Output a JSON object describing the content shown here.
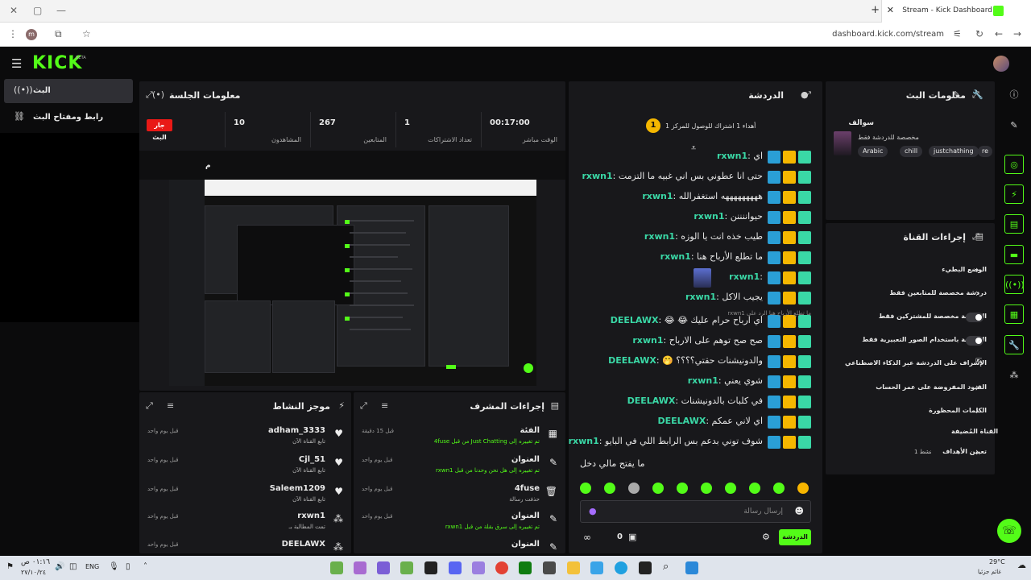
{
  "browser": {
    "tab_title": "Stream - Kick Dashboard",
    "tab_close": "✕",
    "new_tab": "+",
    "url": "dashboard.kick.com/stream",
    "profile_initial": "m"
  },
  "app": {
    "logo": "KICK",
    "beta": "BETA"
  },
  "nav": {
    "items": [
      {
        "label": "البث",
        "icon": "stream-icon"
      },
      {
        "label": "رابط ومفتاح البث",
        "icon": "link-icon"
      }
    ]
  },
  "session": {
    "title": "معلومات الجلسة",
    "live_badge": "جار البث",
    "stats": [
      {
        "value": "00:17:00",
        "label": "الوقت مباشر"
      },
      {
        "value": "1",
        "label": "تعداد الاشتراكات"
      },
      {
        "value": "267",
        "label": "المتابعين"
      },
      {
        "value": "10",
        "label": "المشاهدون"
      }
    ],
    "m_label": "م"
  },
  "chat": {
    "title": "الدردشة",
    "pinned": "أهداء 1 اشتراك للوصول للمركز 1",
    "pinned_rank": "1",
    "reply_hint": "ما تطلع الأرباح هنا",
    "reply_user": "الرد على rxwn1",
    "messages": [
      {
        "user": "rxwn1",
        "color": "#3ad8a6",
        "text": "اي"
      },
      {
        "user": "rxwn1",
        "color": "#3ad8a6",
        "text": "حتى انا عطوني بس اني غبيه ما التزمت"
      },
      {
        "user": "rxwn1",
        "color": "#3ad8a6",
        "text": "هههههههههه استغفرالله"
      },
      {
        "user": "rxwn1",
        "color": "#3ad8a6",
        "text": "حيواننننن"
      },
      {
        "user": "rxwn1",
        "color": "#3ad8a6",
        "text": "طيب خذه انت يا الوزه"
      },
      {
        "user": "rxwn1",
        "color": "#3ad8a6",
        "text": "ما تطلع الأرباح هنا"
      },
      {
        "user": "rxwn1",
        "color": "#3ad8a6",
        "text": ""
      },
      {
        "user": "rxwn1",
        "color": "#3ad8a6",
        "text": "يجيب الاكل"
      },
      {
        "user": "DEELAWX",
        "color": "#3ad8a6",
        "text": "اي ارباح حرام عليك 😂 😂"
      },
      {
        "user": "rxwn1",
        "color": "#3ad8a6",
        "text": "صح صح توهم على الارباح"
      },
      {
        "user": "DEELAWX",
        "color": "#3ad8a6",
        "text": "والدونيشنات حقتي؟؟؟؟ 🤭"
      },
      {
        "user": "rxwn1",
        "color": "#3ad8a6",
        "text": "شوي يعني"
      },
      {
        "user": "DEELAWX",
        "color": "#3ad8a6",
        "text": "في كلبات بالدونيشنات"
      },
      {
        "user": "DEELAWX",
        "color": "#3ad8a6",
        "text": "اي لاني عمكم"
      },
      {
        "user": "rxwn1",
        "color": "#3ad8a6",
        "text": "شوف توني بدعم بس الرابط اللي في البايو"
      }
    ],
    "last_line": "ما يفتح مالي دخل",
    "input_placeholder": "إرسال رسالة",
    "send_label": "الدردشة",
    "count": "0"
  },
  "stream_info": {
    "title": "معلومات البث",
    "stream_title": "سوالف",
    "subtitle": "مخصصة للدردشة فقط",
    "tags": [
      "Arabic",
      "chill",
      "justchathing",
      "re"
    ]
  },
  "channel_actions": {
    "title": "إجراءات القناة",
    "rows": [
      {
        "label": "الوضع البطيء",
        "ctl": "chevron"
      },
      {
        "label": "دردشة مخصصة للمتابعين فقط",
        "ctl": "chevron"
      },
      {
        "label": "الدردشة مخصصة للمشتركين فقط",
        "ctl": "toggle"
      },
      {
        "label": "الدردشة باستخدام الصور التعبيرية فقط",
        "ctl": "toggle"
      },
      {
        "label": "الإشراف على الدردشة عبر الذكاء الاصطناعي",
        "ctl": "ext"
      },
      {
        "label": "القيود المفروضة على عمر الحساب",
        "ctl": "chevron"
      },
      {
        "label": "الكلمات المحظورة",
        "ctl": "chevron"
      }
    ],
    "featured_label": "القناة المُضيفة",
    "goals_label": "تعيين الأهداف",
    "goals_value": "1 نشط"
  },
  "activity": {
    "title": "موجز النشاط",
    "items": [
      {
        "user": "adham_3333",
        "sub": "تابع القناة الآن",
        "time": "قبل يوم واحد",
        "icon": "heart-icon"
      },
      {
        "user": "Cjl_51",
        "sub": "تابع القناة الآن",
        "time": "قبل يوم واحد",
        "icon": "heart-icon"
      },
      {
        "user": "Saleem1209",
        "sub": "تابع القناة الآن",
        "time": "قبل يوم واحد",
        "icon": "heart-icon"
      },
      {
        "user": "rxwn1",
        "sub": "تمت المطالبة بـ",
        "time": "قبل يوم واحد",
        "icon": "redeem-icon"
      },
      {
        "user": "DEELAWX",
        "sub": "",
        "time": "قبل يوم واحد",
        "icon": "redeem-icon"
      }
    ]
  },
  "mod_actions": {
    "title": "إجراءات المشرف",
    "items": [
      {
        "main": "الفئة",
        "sub": "تم تغييره إلى Just Chatting من قبل 4fuse",
        "time": "قبل 15 دقيقة",
        "icon": "category-icon"
      },
      {
        "main": "العنوان",
        "sub": "تم تغييره إلى هل نحن وحدنا من قبل rxwn1",
        "time": "قبل يوم واحد",
        "icon": "title-icon"
      },
      {
        "main": "4fuse",
        "sub": "حذفت رسالة",
        "time": "قبل يوم واحد",
        "icon": "trash-icon"
      },
      {
        "main": "العنوان",
        "sub": "تم تغييره إلى سرق بقلة من قبل rxwn1",
        "time": "قبل يوم واحد",
        "icon": "title-icon"
      },
      {
        "main": "العنوان",
        "sub": "",
        "time": "",
        "icon": "title-icon"
      }
    ]
  },
  "taskbar": {
    "lang": "ENG",
    "time": "٠١:١٦ ص",
    "date": "٢٧/١٠/٢٤",
    "weather": "29°C",
    "weather_sub": "غائم جزئيا"
  },
  "colors": {
    "accent": "#53fc18",
    "panel": "#18181b",
    "bg": "#0b0b0c",
    "live": "#e91916"
  }
}
